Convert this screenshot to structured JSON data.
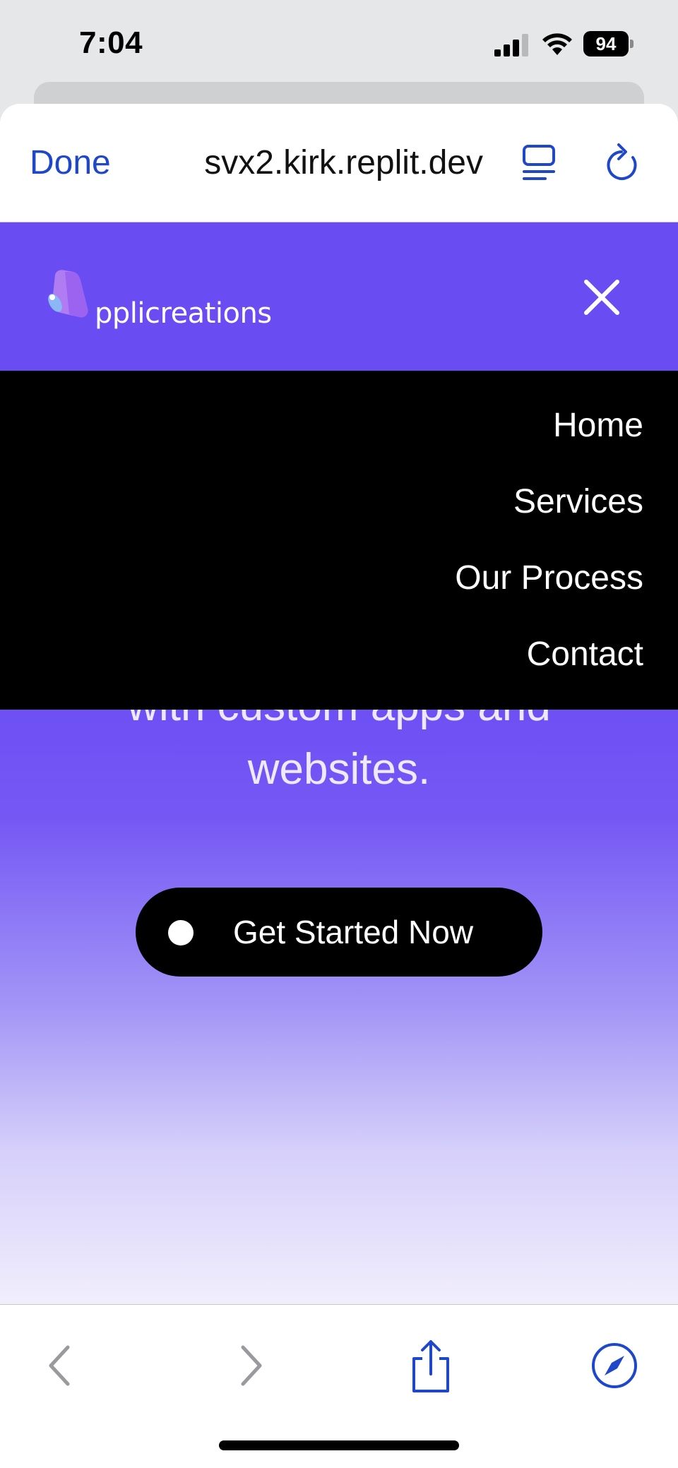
{
  "status_bar": {
    "time": "7:04",
    "battery": "94",
    "icons": [
      "signal-icon",
      "wifi-icon",
      "battery-icon"
    ]
  },
  "browser": {
    "done_label": "Done",
    "url": "svx2.kirk.replit.dev",
    "accent_color": "#1f47c9",
    "icons": [
      "reader-icon",
      "reload-icon"
    ]
  },
  "site": {
    "logo_text": "pplicreations",
    "brand_color": "#6a4cf3",
    "menu": {
      "items": [
        {
          "label": "Home"
        },
        {
          "label": "Services"
        },
        {
          "label": "Our Process"
        },
        {
          "label": "Contact"
        }
      ]
    },
    "hero": {
      "line1": "with custom apps and",
      "line2": "websites."
    },
    "cta": {
      "label": "Get Started Now"
    }
  },
  "toolbar": {
    "icons": [
      "back-icon",
      "forward-icon",
      "share-icon",
      "compass-icon"
    ]
  }
}
